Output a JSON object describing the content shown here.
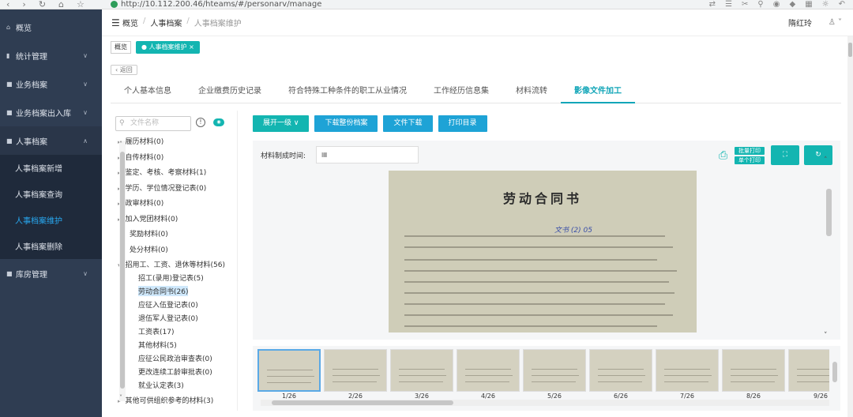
{
  "browser": {
    "url": "http://10.112.200.46/hteams/#/personarv/manage",
    "nav_icons": [
      "back-icon",
      "forward-icon",
      "reload-icon",
      "home-icon",
      "star-icon"
    ],
    "ext_icons": [
      "extension-icons"
    ]
  },
  "sidebar": {
    "items": [
      {
        "label": "概览",
        "icon": "home-icon"
      },
      {
        "label": "统计管理",
        "icon": "chart-icon"
      },
      {
        "label": "业务档案",
        "icon": "folder-icon"
      },
      {
        "label": "业务档案出入库",
        "icon": "inout-icon"
      },
      {
        "label": "人事档案",
        "icon": "person-folder-icon"
      },
      {
        "label": "库房管理",
        "icon": "warehouse-icon"
      }
    ],
    "subitems": [
      {
        "label": "人事档案新增"
      },
      {
        "label": "人事档案查询"
      },
      {
        "label": "人事档案维护"
      },
      {
        "label": "人事档案删除"
      }
    ]
  },
  "topbar": {
    "crumbs": [
      "概览",
      "人事档案",
      "人事档案维护"
    ],
    "user": "隋红玲"
  },
  "tagbar": {
    "tags": [
      "概览",
      "人事档案维护"
    ]
  },
  "back_label": "返回",
  "tabs": [
    "个人基本信息",
    "企业缴费历史记录",
    "符合特殊工种条件的职工从业情况",
    "工作经历信息集",
    "材料流转",
    "影像文件加工"
  ],
  "tree": {
    "search_placeholder": "文件名称",
    "nodes": [
      "履历材料(0)",
      "自传材料(0)",
      "鉴定、考核、考察材料(1)",
      "学历、学位情况登记表(0)",
      "政审材料(0)",
      "加入党团材料(0)",
      "奖励材料(0)",
      "处分材料(0)",
      "招用工、工资、退休等材料(56)"
    ],
    "children": [
      "招工(录用)登记表(5)",
      "劳动合同书(26)",
      "应征入伍登记表(0)",
      "退伍军人登记表(0)",
      "工资表(17)",
      "其他材料(5)",
      "应征公民政治审查表(0)",
      "更改连续工龄审批表(0)",
      "就业认定表(3)"
    ],
    "last_node": "其他可供组织参考的材料(3)"
  },
  "toolbar": {
    "expand": "展开一级",
    "download_archive": "下载整份档案",
    "download_file": "文件下载",
    "print_toc": "打印目录"
  },
  "viewer": {
    "date_label": "材料制成时间:",
    "batch_print": "批量打印",
    "single_print": "单个打印",
    "doc_title": "劳动合同书",
    "doc_handwriting": "文书 (2) 05"
  },
  "thumbnails": [
    "1/26",
    "2/26",
    "3/26",
    "4/26",
    "5/26",
    "6/26",
    "7/26",
    "8/26",
    "9/26"
  ],
  "colors": {
    "accent": "#13b5b1",
    "sidebar_bg": "#2f3d52",
    "active_link": "#28a8f0",
    "tab_active": "#13a6b8"
  }
}
